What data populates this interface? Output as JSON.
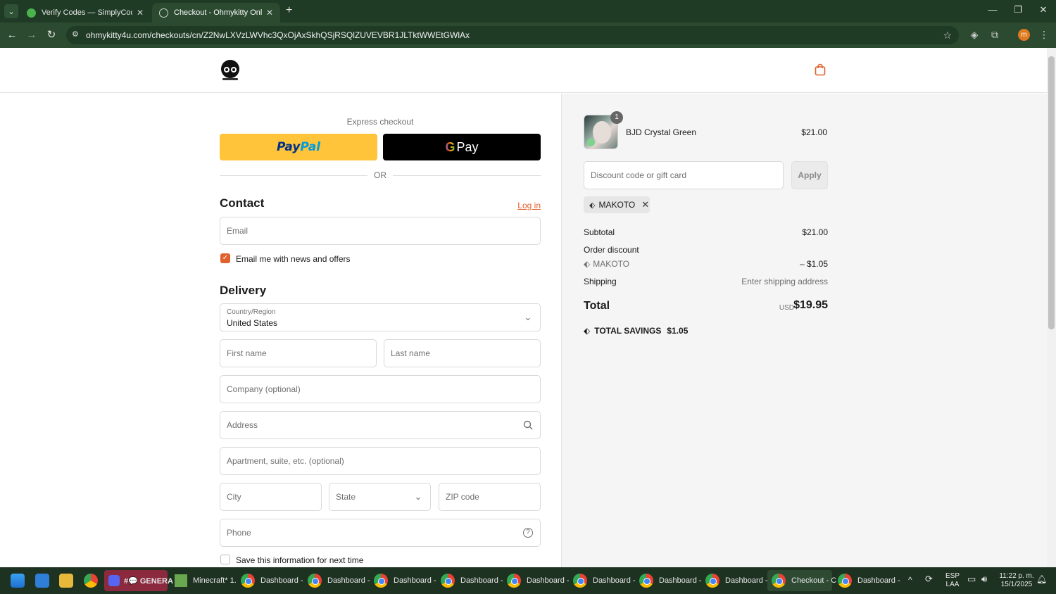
{
  "browser": {
    "tabs": [
      {
        "title": "Verify Codes — SimplyCodes",
        "active": false
      },
      {
        "title": "Checkout - Ohmykitty Online St",
        "active": true
      }
    ],
    "url": "ohmykitty4u.com/checkouts/cn/Z2NwLXVzLWVhc3QxOjAxSkhQSjRSQlZUVEVBR1JLTktWWEtGWlAx",
    "profile_initial": "m"
  },
  "checkout": {
    "express_label": "Express checkout",
    "paypal_label_1": "Pay",
    "paypal_label_2": "Pal",
    "gpay_label": "Pay",
    "or_label": "OR",
    "contact_heading": "Contact",
    "login_link": "Log in",
    "email_placeholder": "Email",
    "news_checkbox_label": "Email me with news and offers",
    "news_checked": true,
    "delivery_heading": "Delivery",
    "country_label": "Country/Region",
    "country_value": "United States",
    "first_name_placeholder": "First name",
    "last_name_placeholder": "Last name",
    "company_placeholder": "Company (optional)",
    "address_placeholder": "Address",
    "apartment_placeholder": "Apartment, suite, etc. (optional)",
    "city_placeholder": "City",
    "state_placeholder": "State",
    "zip_placeholder": "ZIP code",
    "phone_placeholder": "Phone",
    "save_info_label": "Save this information for next time",
    "save_checked": false,
    "accent_color": "#e0612b"
  },
  "summary": {
    "product": {
      "name": "BJD Crystal Green",
      "quantity": "1",
      "price": "$21.00"
    },
    "discount_placeholder": "Discount code or gift card",
    "apply_label": "Apply",
    "applied_code": "MAKOTO",
    "subtotal_label": "Subtotal",
    "subtotal_value": "$21.00",
    "order_discount_label": "Order discount",
    "discount_code_line": "MAKOTO",
    "discount_value": "– $1.05",
    "shipping_label": "Shipping",
    "shipping_value": "Enter shipping address",
    "total_label": "Total",
    "currency": "USD",
    "total_value": "$19.95",
    "savings_label": "TOTAL SAVINGS",
    "savings_value": "$1.05"
  },
  "taskbar": {
    "apps": [
      {
        "label": "#💬 GENERA"
      },
      {
        "label": "Minecraft* 1."
      },
      {
        "label": "Dashboard -"
      },
      {
        "label": "Dashboard -"
      },
      {
        "label": "Dashboard -"
      },
      {
        "label": "Dashboard -"
      },
      {
        "label": "Dashboard -"
      },
      {
        "label": "Dashboard -"
      },
      {
        "label": "Dashboard -"
      },
      {
        "label": "Dashboard -"
      },
      {
        "label": "Checkout - C"
      },
      {
        "label": "Dashboard -"
      }
    ],
    "language_1": "ESP",
    "language_2": "LAA",
    "time": "11:22 p. m.",
    "date": "15/1/2025"
  }
}
